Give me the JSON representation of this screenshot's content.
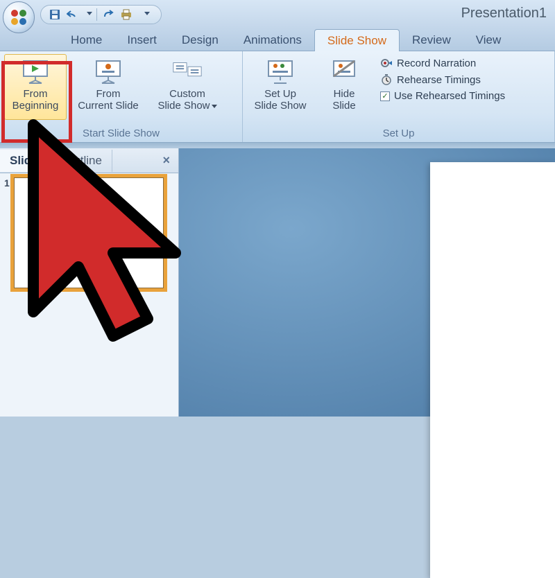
{
  "title": "Presentation1",
  "qat": {
    "save": "save-icon",
    "undo": "undo-icon",
    "redo": "redo-icon",
    "print": "quick-print-icon"
  },
  "tabs": [
    "Home",
    "Insert",
    "Design",
    "Animations",
    "Slide Show",
    "Review",
    "View"
  ],
  "active_tab": 4,
  "ribbon": {
    "groups": [
      {
        "label": "Start Slide Show",
        "buttons": [
          {
            "line1": "From",
            "line2": "Beginning",
            "icon": "from-beginning-icon"
          },
          {
            "line1": "From",
            "line2": "Current Slide",
            "icon": "from-current-icon"
          },
          {
            "line1": "Custom",
            "line2": "Slide Show",
            "icon": "custom-show-icon",
            "dropdown": true
          }
        ]
      },
      {
        "label": "Set Up",
        "buttons": [
          {
            "line1": "Set Up",
            "line2": "Slide Show",
            "icon": "setup-icon"
          },
          {
            "line1": "Hide",
            "line2": "Slide",
            "icon": "hide-slide-icon"
          }
        ],
        "options": [
          {
            "label": "Record Narration",
            "icon": "record-icon"
          },
          {
            "label": "Rehearse Timings",
            "icon": "rehearse-icon"
          },
          {
            "label": "Use Rehearsed Timings",
            "checkbox": true,
            "checked": true
          }
        ]
      }
    ]
  },
  "panes": {
    "tabs": [
      "Slides",
      "Outline"
    ],
    "active": 0,
    "slide_numbers": [
      "1"
    ]
  },
  "highlight": {
    "target": "from-beginning-button"
  }
}
